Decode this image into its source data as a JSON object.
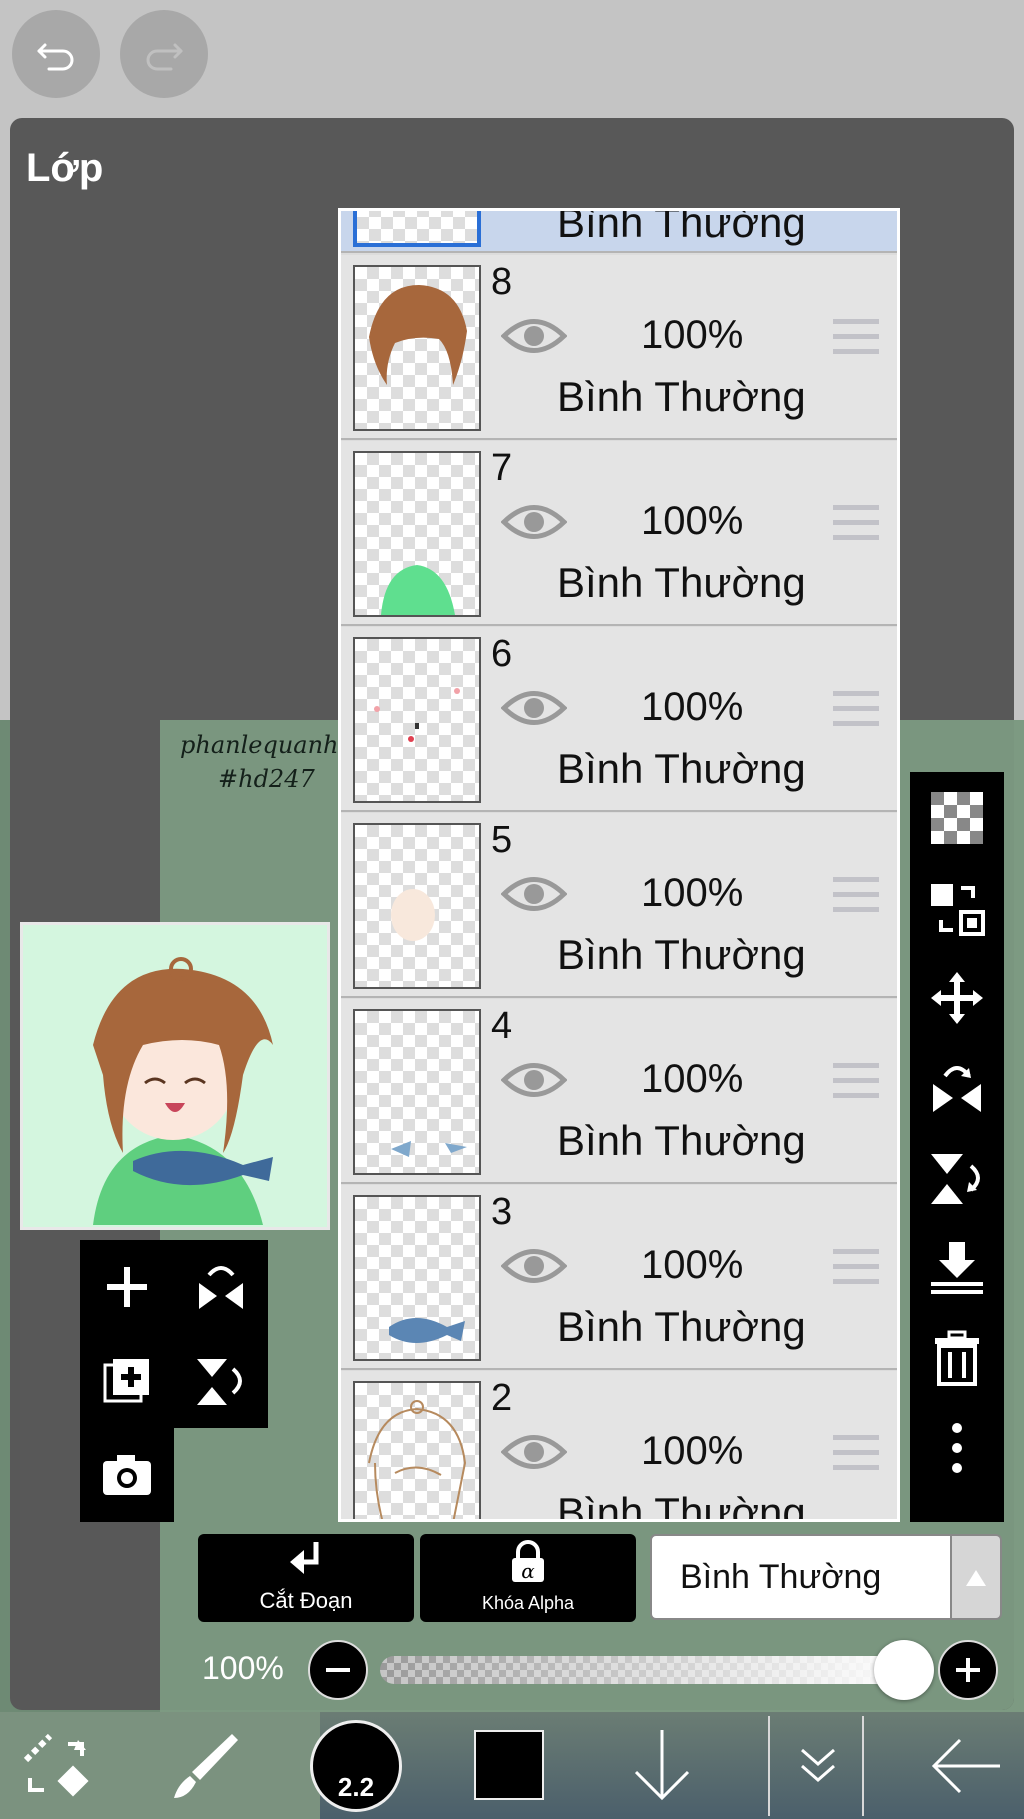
{
  "toolbar": {
    "undo_icon": "undo-arrow-icon",
    "redo_icon": "redo-arrow-icon"
  },
  "panel": {
    "title": "Lớp",
    "signature_line1": "phanlequanhu",
    "signature_line2": "#hd247"
  },
  "layers": [
    {
      "number": "",
      "opacity": "",
      "blend": "Bình Thường",
      "selected": true
    },
    {
      "number": "8",
      "opacity": "100%",
      "blend": "Bình Thường"
    },
    {
      "number": "7",
      "opacity": "100%",
      "blend": "Bình Thường"
    },
    {
      "number": "6",
      "opacity": "100%",
      "blend": "Bình Thường"
    },
    {
      "number": "5",
      "opacity": "100%",
      "blend": "Bình Thường"
    },
    {
      "number": "4",
      "opacity": "100%",
      "blend": "Bình Thường"
    },
    {
      "number": "3",
      "opacity": "100%",
      "blend": "Bình Thường"
    },
    {
      "number": "2",
      "opacity": "100%",
      "blend": "Bình Thường"
    }
  ],
  "actions": {
    "clip_label": "Cắt Đoạn",
    "alpha_lock_label": "Khóa Alpha",
    "blend_mode": "Bình Thường"
  },
  "opacity": {
    "label": "100%",
    "value": 1.0
  },
  "bottom": {
    "brush_size": "2.2",
    "color": "#000000"
  },
  "colors": {
    "panel_bg": "#585858",
    "selected_row": "#c8d6ec",
    "selection_border": "#2a6fd6"
  }
}
